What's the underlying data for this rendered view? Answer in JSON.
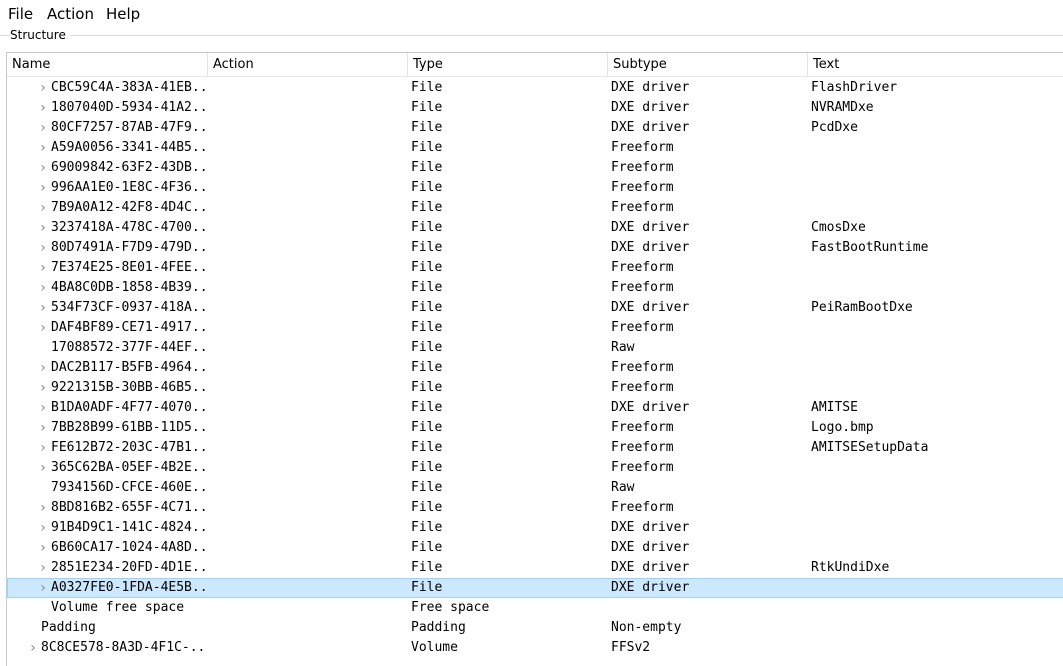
{
  "menu": {
    "items": [
      "File",
      "Action",
      "Help"
    ]
  },
  "structure": {
    "title": "Structure",
    "columns": [
      "Name",
      "Action",
      "Type",
      "Subtype",
      "Text"
    ],
    "rows": [
      {
        "name": "CBC59C4A-383A-41EB...",
        "action": "",
        "type": "File",
        "subtype": "DXE driver",
        "text": "FlashDriver",
        "level": 2,
        "expandable": true,
        "selected": false
      },
      {
        "name": "1807040D-5934-41A2...",
        "action": "",
        "type": "File",
        "subtype": "DXE driver",
        "text": "NVRAMDxe",
        "level": 2,
        "expandable": true,
        "selected": false
      },
      {
        "name": "80CF7257-87AB-47F9...",
        "action": "",
        "type": "File",
        "subtype": "DXE driver",
        "text": "PcdDxe",
        "level": 2,
        "expandable": true,
        "selected": false
      },
      {
        "name": "A59A0056-3341-44B5...",
        "action": "",
        "type": "File",
        "subtype": "Freeform",
        "text": "",
        "level": 2,
        "expandable": true,
        "selected": false
      },
      {
        "name": "69009842-63F2-43DB...",
        "action": "",
        "type": "File",
        "subtype": "Freeform",
        "text": "",
        "level": 2,
        "expandable": true,
        "selected": false
      },
      {
        "name": "996AA1E0-1E8C-4F36...",
        "action": "",
        "type": "File",
        "subtype": "Freeform",
        "text": "",
        "level": 2,
        "expandable": true,
        "selected": false
      },
      {
        "name": "7B9A0A12-42F8-4D4C...",
        "action": "",
        "type": "File",
        "subtype": "Freeform",
        "text": "",
        "level": 2,
        "expandable": true,
        "selected": false
      },
      {
        "name": "3237418A-478C-4700...",
        "action": "",
        "type": "File",
        "subtype": "DXE driver",
        "text": "CmosDxe",
        "level": 2,
        "expandable": true,
        "selected": false
      },
      {
        "name": "80D7491A-F7D9-479D...",
        "action": "",
        "type": "File",
        "subtype": "DXE driver",
        "text": "FastBootRuntime",
        "level": 2,
        "expandable": true,
        "selected": false
      },
      {
        "name": "7E374E25-8E01-4FEE...",
        "action": "",
        "type": "File",
        "subtype": "Freeform",
        "text": "",
        "level": 2,
        "expandable": true,
        "selected": false
      },
      {
        "name": "4BA8C0DB-1858-4B39...",
        "action": "",
        "type": "File",
        "subtype": "Freeform",
        "text": "",
        "level": 2,
        "expandable": true,
        "selected": false
      },
      {
        "name": "534F73CF-0937-418A...",
        "action": "",
        "type": "File",
        "subtype": "DXE driver",
        "text": "PeiRamBootDxe",
        "level": 2,
        "expandable": true,
        "selected": false
      },
      {
        "name": "DAF4BF89-CE71-4917...",
        "action": "",
        "type": "File",
        "subtype": "Freeform",
        "text": "",
        "level": 2,
        "expandable": true,
        "selected": false
      },
      {
        "name": "17088572-377F-44EF...",
        "action": "",
        "type": "File",
        "subtype": "Raw",
        "text": "",
        "level": 2,
        "expandable": false,
        "selected": false
      },
      {
        "name": "DAC2B117-B5FB-4964...",
        "action": "",
        "type": "File",
        "subtype": "Freeform",
        "text": "",
        "level": 2,
        "expandable": true,
        "selected": false
      },
      {
        "name": "9221315B-30BB-46B5...",
        "action": "",
        "type": "File",
        "subtype": "Freeform",
        "text": "",
        "level": 2,
        "expandable": true,
        "selected": false
      },
      {
        "name": "B1DA0ADF-4F77-4070...",
        "action": "",
        "type": "File",
        "subtype": "DXE driver",
        "text": "AMITSE",
        "level": 2,
        "expandable": true,
        "selected": false
      },
      {
        "name": "7BB28B99-61BB-11D5...",
        "action": "",
        "type": "File",
        "subtype": "Freeform",
        "text": "Logo.bmp",
        "level": 2,
        "expandable": true,
        "selected": false
      },
      {
        "name": "FE612B72-203C-47B1...",
        "action": "",
        "type": "File",
        "subtype": "Freeform",
        "text": "AMITSESetupData",
        "level": 2,
        "expandable": true,
        "selected": false
      },
      {
        "name": "365C62BA-05EF-4B2E...",
        "action": "",
        "type": "File",
        "subtype": "Freeform",
        "text": "",
        "level": 2,
        "expandable": true,
        "selected": false
      },
      {
        "name": "7934156D-CFCE-460E...",
        "action": "",
        "type": "File",
        "subtype": "Raw",
        "text": "",
        "level": 2,
        "expandable": false,
        "selected": false
      },
      {
        "name": "8BD816B2-655F-4C71...",
        "action": "",
        "type": "File",
        "subtype": "Freeform",
        "text": "",
        "level": 2,
        "expandable": true,
        "selected": false
      },
      {
        "name": "91B4D9C1-141C-4824...",
        "action": "",
        "type": "File",
        "subtype": "DXE driver",
        "text": "",
        "level": 2,
        "expandable": true,
        "selected": false
      },
      {
        "name": "6B60CA17-1024-4A8D...",
        "action": "",
        "type": "File",
        "subtype": "DXE driver",
        "text": "",
        "level": 2,
        "expandable": true,
        "selected": false
      },
      {
        "name": "2851E234-20FD-4D1E...",
        "action": "",
        "type": "File",
        "subtype": "DXE driver",
        "text": "RtkUndiDxe",
        "level": 2,
        "expandable": true,
        "selected": false
      },
      {
        "name": "A0327FE0-1FDA-4E5B...",
        "action": "",
        "type": "File",
        "subtype": "DXE driver",
        "text": "",
        "level": 2,
        "expandable": true,
        "selected": true
      },
      {
        "name": "Volume free space",
        "action": "",
        "type": "Free space",
        "subtype": "",
        "text": "",
        "level": 2,
        "expandable": false,
        "selected": false
      },
      {
        "name": "Padding",
        "action": "",
        "type": "Padding",
        "subtype": "Non-empty",
        "text": "",
        "level": 1,
        "expandable": false,
        "selected": false
      },
      {
        "name": "8C8CE578-8A3D-4F1C-...",
        "action": "",
        "type": "Volume",
        "subtype": "FFSv2",
        "text": "",
        "level": 1,
        "expandable": true,
        "selected": false
      }
    ]
  },
  "icons": {
    "expander": "chevron-right-icon"
  },
  "colors": {
    "selection_background": "#cce8ff",
    "selection_border": "#99d1ff",
    "expander": "#8a8a8a"
  }
}
